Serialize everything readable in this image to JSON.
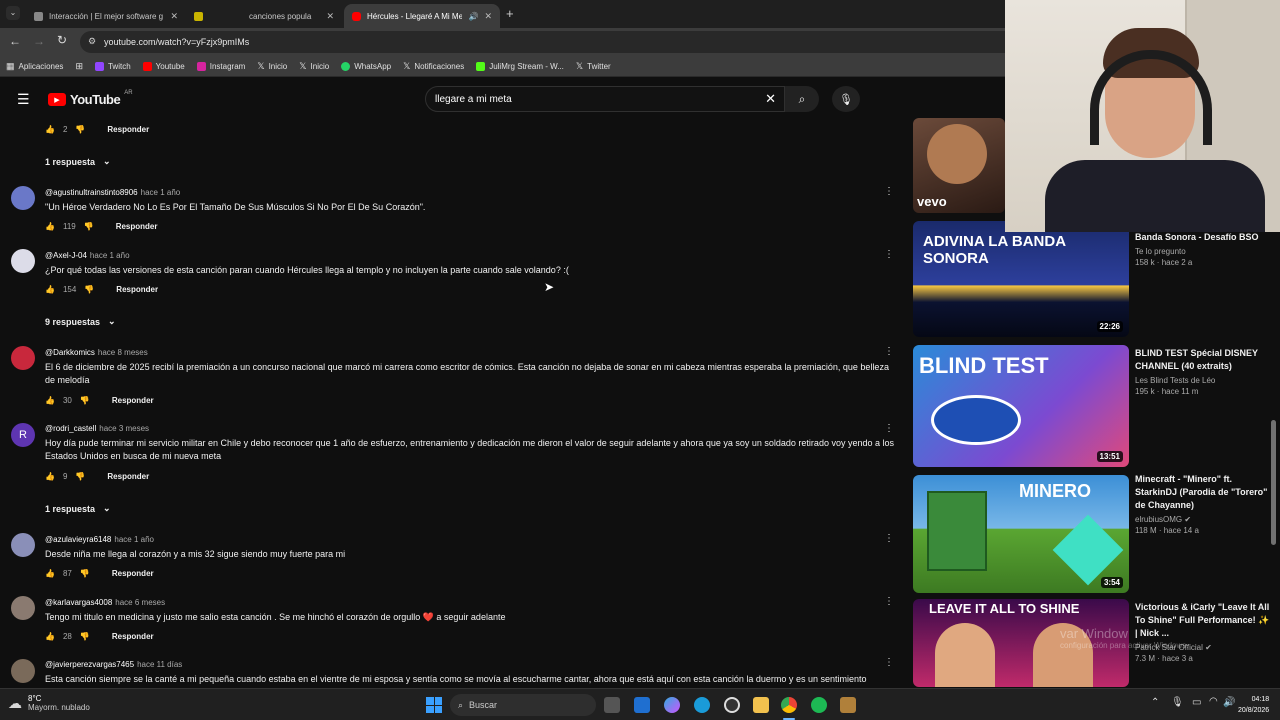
{
  "browser": {
    "tabs": [
      {
        "title": "Interacción | El mejor software g",
        "active": false
      },
      {
        "title": "canciones popula",
        "active": false
      },
      {
        "title": "Hércules - Llegaré A Mi Me",
        "active": true
      }
    ],
    "url": "youtube.com/watch?v=yFzjx9pmIMs",
    "bookmarks": [
      "Aplicaciones",
      "Twitch",
      "Youtube",
      "Instagram",
      "Inicio",
      "Inicio",
      "WhatsApp",
      "Notificaciones",
      "JuliMrg Stream - W...",
      "Twitter"
    ]
  },
  "youtube": {
    "logo_text": "YouTube",
    "region": "AR",
    "search_query": "llegare a mi meta"
  },
  "comments": {
    "top_partial": {
      "likes": "2",
      "reply_label": "Responder",
      "replies_label": "1 respuesta"
    },
    "items": [
      {
        "author": "@agustinultrainstinto8906",
        "time": "hace 1 año",
        "text": "\"Un Héroe Verdadero No Lo Es Por El Tamaño De Sus Músculos Si No Por El De Su Corazón\".",
        "likes": "119",
        "reply_label": "Responder",
        "replies_label": ""
      },
      {
        "author": "@Axel-J-04",
        "time": "hace 1 año",
        "text": "¿Por qué todas las versiones de esta canción paran cuando Hércules llega al templo y no incluyen la parte cuando sale volando? :(",
        "likes": "154",
        "reply_label": "Responder",
        "replies_label": "9 respuestas"
      },
      {
        "author": "@Darkkomics",
        "time": "hace 8 meses",
        "text": "El 6 de diciembre de 2025 recibí la premiación a un concurso nacional que marcó mi carrera como escritor de cómics. Esta canción no dejaba de sonar en mi cabeza mientras esperaba la premiación, que belleza de melodía",
        "likes": "30",
        "reply_label": "Responder",
        "replies_label": ""
      },
      {
        "author": "@rodri_castell",
        "time": "hace 3 meses",
        "text": "Hoy día pude terminar mi servicio militar en Chile y debo reconocer que 1 año de esfuerzo, entrenamiento y dedicación me dieron el valor de seguir adelante y ahora que ya soy un soldado retirado voy yendo a los Estados Unidos en busca de mi nueva meta",
        "likes": "9",
        "reply_label": "Responder",
        "replies_label": "1 respuesta",
        "avatar_letter": "R"
      },
      {
        "author": "@azulavieyra6148",
        "time": "hace 1 año",
        "text": "Desde niña me llega al corazón y a mis 32 sigue siendo muy fuerte para mi",
        "likes": "87",
        "reply_label": "Responder",
        "replies_label": ""
      },
      {
        "author": "@karlavargas4008",
        "time": "hace 6 meses",
        "text": "Tengo mi titulo en medicina y justo me salio esta canción . Se me hinchó el corazón de orgullo ❤️ a seguir adelante",
        "likes": "28",
        "reply_label": "Responder",
        "replies_label": ""
      },
      {
        "author": "@javierperezvargas7465",
        "time": "hace 11 días",
        "text": "Esta canción siempre se la canté a mi pequeña cuando estaba en el vientre de mi esposa y sentía como se movía al escucharme cantar, ahora que está aquí con esta canción la duermo y es un sentimiento",
        "likes": "",
        "reply_label": "",
        "replies_label": ""
      }
    ]
  },
  "related": [
    {
      "title": "",
      "channel": "",
      "views": "",
      "age": "",
      "duration": "",
      "thumb_text": "vevo"
    },
    {
      "title": "Banda Sonora - Desafío BSO",
      "channel": "Te lo pregunto",
      "views": "158 k",
      "age": "hace 2 a",
      "duration": "22:26",
      "thumb_text": "ADIVINA LA BANDA SONORA"
    },
    {
      "title": "BLIND TEST Spécial DISNEY CHANNEL (40 extraits)",
      "channel": "Les Blind Tests de Léo",
      "views": "195 k",
      "age": "hace 11 m",
      "duration": "13:51",
      "thumb_text": "BLIND TEST"
    },
    {
      "title": "Minecraft - \"Minero\" ft. StarkinDJ (Parodia de \"Torero\" de Chayanne)",
      "channel": "elrubiusOMG",
      "views": "118 M",
      "age": "hace 14 a",
      "duration": "3:54",
      "thumb_text": "MINERO"
    },
    {
      "title": "Victorious & iCarly \"Leave It All To Shine\" Full Performance! ✨ | Nick ...",
      "channel": "Patrick Star Official",
      "views": "7.3 M",
      "age": "hace 3 a",
      "duration": "",
      "thumb_text": "LEAVE IT ALL TO SHINE"
    }
  ],
  "watermark": {
    "line1": "var Window",
    "line2": "configuración para activar Windows."
  },
  "taskbar": {
    "weather_temp": "8°C",
    "weather_desc": "Mayorm. nublado",
    "search_label": "Buscar",
    "time": "04:18",
    "date": "20/8/2026"
  },
  "colors": {
    "bg": "#0f0f0f",
    "accent": "#ff0000",
    "link": "#3ea6ff"
  }
}
